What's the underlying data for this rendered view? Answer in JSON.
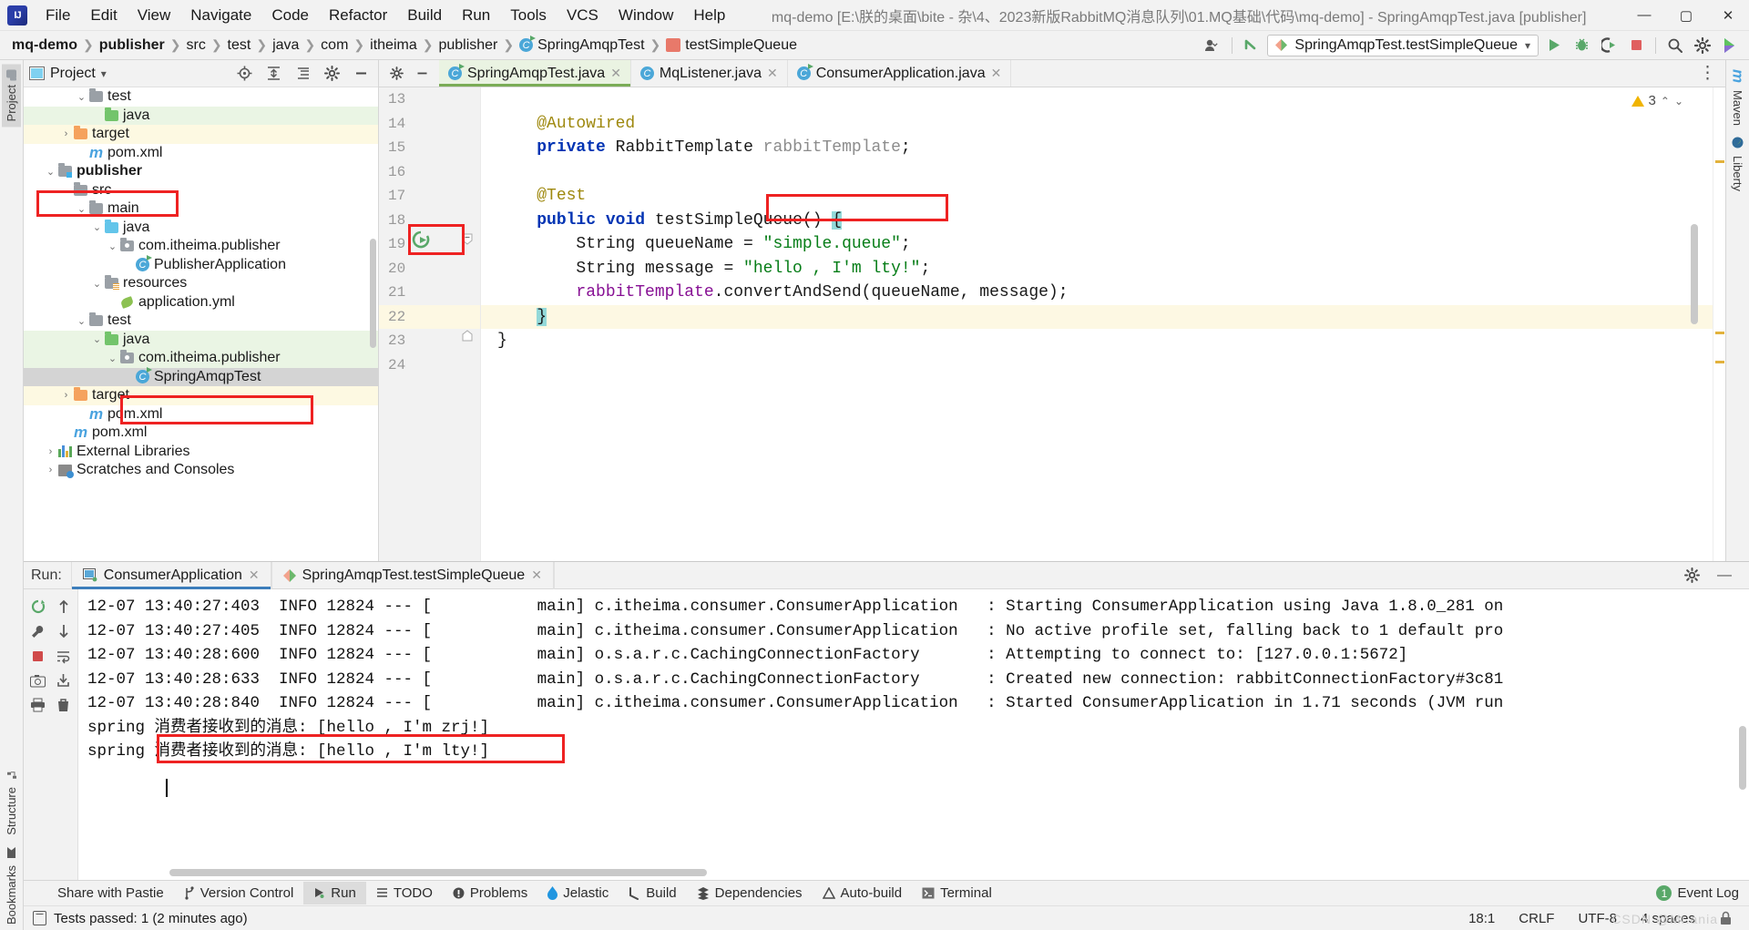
{
  "window": {
    "title": "mq-demo [E:\\朕的桌面\\bite - 杂\\4、2023新版RabbitMQ消息队列\\01.MQ基础\\代码\\mq-demo] - SpringAmqpTest.java [publisher]",
    "minimize": "—",
    "maximize": "▢",
    "close": "✕"
  },
  "menu": [
    {
      "label": "File"
    },
    {
      "label": "Edit"
    },
    {
      "label": "View"
    },
    {
      "label": "Navigate"
    },
    {
      "label": "Code"
    },
    {
      "label": "Refactor"
    },
    {
      "label": "Build"
    },
    {
      "label": "Run"
    },
    {
      "label": "Tools"
    },
    {
      "label": "VCS"
    },
    {
      "label": "Window"
    },
    {
      "label": "Help"
    }
  ],
  "breadcrumbs": [
    {
      "label": "mq-demo",
      "bold": true
    },
    {
      "label": "publisher",
      "bold": true
    },
    {
      "label": "src",
      "bold": false
    },
    {
      "label": "test",
      "bold": false
    },
    {
      "label": "java",
      "bold": false
    },
    {
      "label": "com",
      "bold": false
    },
    {
      "label": "itheima",
      "bold": false
    },
    {
      "label": "publisher",
      "bold": false
    },
    {
      "label": "SpringAmqpTest",
      "bold": false
    },
    {
      "label": "testSimpleQueue",
      "bold": false
    }
  ],
  "toolbar": {
    "run_config": "SpringAmqpTest.testSimpleQueue",
    "run_config_caret": "▾",
    "run_button": "▶",
    "debug_button": "debug-icon",
    "run_coverage_button": "coverage-icon",
    "stop_button": "■",
    "search_button": "search-icon",
    "settings_button": "gear-icon",
    "account_button": "account-icon",
    "updates_button": "update-icon"
  },
  "left_strip": {
    "project": "Project",
    "structure": "Structure",
    "bookmarks": "Bookmarks"
  },
  "right_strip": {
    "maven": "Maven",
    "liberty": "Liberty"
  },
  "project_panel": {
    "title": "Project",
    "title_caret": "▾",
    "actions": [
      "locate-icon",
      "expand-all-icon",
      "collapse-all-icon",
      "settings-icon",
      "hide-icon"
    ],
    "tree": [
      {
        "label": "test",
        "indent": 3,
        "twist": "⌄",
        "icon": "folder-gray",
        "bold": false,
        "row": "plain"
      },
      {
        "label": "java",
        "indent": 4,
        "twist": "",
        "icon": "folder-green",
        "bold": false,
        "row": "green"
      },
      {
        "label": "target",
        "indent": 2,
        "twist": "›",
        "icon": "folder-orange",
        "bold": false,
        "row": "yellow"
      },
      {
        "label": "pom.xml",
        "indent": 3,
        "twist": "",
        "icon": "maven",
        "bold": false,
        "row": "plain"
      },
      {
        "label": "publisher",
        "indent": 1,
        "twist": "⌄",
        "icon": "module",
        "bold": true,
        "row": "plain"
      },
      {
        "label": "src",
        "indent": 2,
        "twist": "⌄",
        "icon": "folder-gray",
        "bold": false,
        "row": "plain"
      },
      {
        "label": "main",
        "indent": 3,
        "twist": "⌄",
        "icon": "folder-gray",
        "bold": false,
        "row": "plain"
      },
      {
        "label": "java",
        "indent": 4,
        "twist": "⌄",
        "icon": "folder-blue",
        "bold": false,
        "row": "plain"
      },
      {
        "label": "com.itheima.publisher",
        "indent": 5,
        "twist": "⌄",
        "icon": "package",
        "bold": false,
        "row": "plain"
      },
      {
        "label": "PublisherApplication",
        "indent": 6,
        "twist": "",
        "icon": "class-run",
        "bold": false,
        "row": "plain"
      },
      {
        "label": "resources",
        "indent": 4,
        "twist": "⌄",
        "icon": "resources",
        "bold": false,
        "row": "plain"
      },
      {
        "label": "application.yml",
        "indent": 5,
        "twist": "",
        "icon": "yaml",
        "bold": false,
        "row": "plain"
      },
      {
        "label": "test",
        "indent": 3,
        "twist": "⌄",
        "icon": "folder-gray",
        "bold": false,
        "row": "plain"
      },
      {
        "label": "java",
        "indent": 4,
        "twist": "⌄",
        "icon": "folder-green",
        "bold": false,
        "row": "green"
      },
      {
        "label": "com.itheima.publisher",
        "indent": 5,
        "twist": "⌄",
        "icon": "package",
        "bold": false,
        "row": "green"
      },
      {
        "label": "SpringAmqpTest",
        "indent": 6,
        "twist": "",
        "icon": "class-run",
        "bold": false,
        "row": "sel"
      },
      {
        "label": "target",
        "indent": 2,
        "twist": "›",
        "icon": "folder-orange",
        "bold": false,
        "row": "yellow"
      },
      {
        "label": "pom.xml",
        "indent": 3,
        "twist": "",
        "icon": "maven",
        "bold": false,
        "row": "plain"
      },
      {
        "label": "pom.xml",
        "indent": 2,
        "twist": "",
        "icon": "maven",
        "bold": false,
        "row": "plain"
      },
      {
        "label": "External Libraries",
        "indent": 1,
        "twist": "›",
        "icon": "libraries",
        "bold": false,
        "row": "plain"
      },
      {
        "label": "Scratches and Consoles",
        "indent": 1,
        "twist": "›",
        "icon": "scratches",
        "bold": false,
        "row": "plain"
      }
    ]
  },
  "editor": {
    "tabs": [
      {
        "label": "SpringAmqpTest.java",
        "icon": "class-run-icon",
        "active": true,
        "close": "✕"
      },
      {
        "label": "MqListener.java",
        "icon": "class-icon",
        "active": false,
        "close": "✕"
      },
      {
        "label": "ConsumerApplication.java",
        "icon": "class-run-icon",
        "active": false,
        "close": "✕"
      }
    ],
    "warnings_count": "3",
    "warnings_up": "⌃",
    "warnings_down": "⌄",
    "options_icon": "⋮",
    "lines": [
      {
        "num": "13",
        "segments": []
      },
      {
        "num": "14",
        "segments": [
          {
            "t": "    ",
            "c": "plain"
          },
          {
            "t": "@Autowired",
            "c": "ann"
          }
        ]
      },
      {
        "num": "15",
        "segments": [
          {
            "t": "    ",
            "c": "plain"
          },
          {
            "t": "private",
            "c": "kw"
          },
          {
            "t": " RabbitTemplate ",
            "c": "plain"
          },
          {
            "t": "rabbitTemplate",
            "c": "fieldname"
          },
          {
            "t": ";",
            "c": "plain"
          }
        ]
      },
      {
        "num": "16",
        "segments": []
      },
      {
        "num": "17",
        "segments": [
          {
            "t": "    ",
            "c": "plain"
          },
          {
            "t": "@Test",
            "c": "ann"
          }
        ]
      },
      {
        "num": "18",
        "segments": [
          {
            "t": "    ",
            "c": "plain"
          },
          {
            "t": "public",
            "c": "kw"
          },
          {
            "t": " ",
            "c": "plain"
          },
          {
            "t": "void",
            "c": "kw"
          },
          {
            "t": " testSimpleQueue() ",
            "c": "plain"
          },
          {
            "t": "{",
            "c": "brace"
          }
        ]
      },
      {
        "num": "19",
        "segments": [
          {
            "t": "        String queueName = ",
            "c": "plain"
          },
          {
            "t": "\"simple.queue\"",
            "c": "str"
          },
          {
            "t": ";",
            "c": "plain"
          }
        ]
      },
      {
        "num": "20",
        "segments": [
          {
            "t": "        String message = ",
            "c": "plain"
          },
          {
            "t": "\"hello , I'm lty!\"",
            "c": "str"
          },
          {
            "t": ";",
            "c": "plain"
          }
        ]
      },
      {
        "num": "21",
        "segments": [
          {
            "t": "        ",
            "c": "plain"
          },
          {
            "t": "rabbitTemplate",
            "c": "fld"
          },
          {
            "t": ".convertAndSend(queueName, message);",
            "c": "plain"
          }
        ]
      },
      {
        "num": "22",
        "segments": [
          {
            "t": "    ",
            "c": "plain"
          },
          {
            "t": "}",
            "c": "brace"
          }
        ]
      },
      {
        "num": "23",
        "segments": [
          {
            "t": "}",
            "c": "plain"
          }
        ]
      },
      {
        "num": "24",
        "segments": []
      }
    ]
  },
  "run_panel": {
    "label": "Run:",
    "tabs": [
      {
        "label": "ConsumerApplication",
        "icon": "spring-app-icon",
        "active": true,
        "close": "✕"
      },
      {
        "label": "SpringAmqpTest.testSimpleQueue",
        "icon": "test-icon",
        "active": false,
        "close": "✕"
      }
    ],
    "settings_icon": "gear-icon",
    "minimize_icon": "—",
    "gutter_buttons": [
      "rerun-icon",
      "scroll-up-icon",
      "wrench-icon",
      "scroll-down-icon",
      "stop-icon",
      "soft-wrap-icon",
      "camera-icon",
      "print-icon",
      "export-icon",
      "trash-icon"
    ],
    "console_lines": [
      "12-07 13:40:27:403  INFO 12824 --- [           main] c.itheima.consumer.ConsumerApplication   : Starting ConsumerApplication using Java 1.8.0_281 on",
      "12-07 13:40:27:405  INFO 12824 --- [           main] c.itheima.consumer.ConsumerApplication   : No active profile set, falling back to 1 default pro",
      "12-07 13:40:28:600  INFO 12824 --- [           main] o.s.a.r.c.CachingConnectionFactory       : Attempting to connect to: [127.0.0.1:5672]",
      "12-07 13:40:28:633  INFO 12824 --- [           main] o.s.a.r.c.CachingConnectionFactory       : Created new connection: rabbitConnectionFactory#3c81",
      "12-07 13:40:28:840  INFO 12824 --- [           main] c.itheima.consumer.ConsumerApplication   : Started ConsumerApplication in 1.71 seconds (JVM run",
      "spring 消费者接收到的消息: [hello , I'm zrj!]",
      "spring 消费者接收到的消息: [hello , I'm lty!]"
    ]
  },
  "toolwindow_bar": [
    {
      "label": "Share with Pastie",
      "icon": "",
      "active": false
    },
    {
      "label": "Version Control",
      "icon": "branch-icon",
      "active": false
    },
    {
      "label": "Run",
      "icon": "run-icon",
      "active": true
    },
    {
      "label": "TODO",
      "icon": "todo-icon",
      "active": false
    },
    {
      "label": "Problems",
      "icon": "problems-icon",
      "active": false
    },
    {
      "label": "Jelastic",
      "icon": "jelastic-icon",
      "active": false
    },
    {
      "label": "Build",
      "icon": "build-icon",
      "active": false
    },
    {
      "label": "Dependencies",
      "icon": "dependencies-icon",
      "active": false
    },
    {
      "label": "Auto-build",
      "icon": "autobuild-icon",
      "active": false
    },
    {
      "label": "Terminal",
      "icon": "terminal-icon",
      "active": false
    }
  ],
  "status_bar": {
    "message": "Tests passed: 1 (2 minutes ago)",
    "event_log": "Event Log",
    "event_log_count": "1",
    "caret_position": "18:1",
    "line_separator": "CRLF",
    "encoding": "UTF-8",
    "indent": "4 spaces",
    "lock_icon": "lock-icon",
    "watermark": "CSDN @Mr.ania"
  },
  "colors": {
    "accent_green": "#59a869",
    "accent_blue": "#3d7ebb",
    "highlight_red": "#ee2222",
    "string_green": "#067d17",
    "keyword_blue": "#0033b3",
    "annotation_yellow": "#9e880d",
    "selection_gray": "#d4d4d4"
  }
}
